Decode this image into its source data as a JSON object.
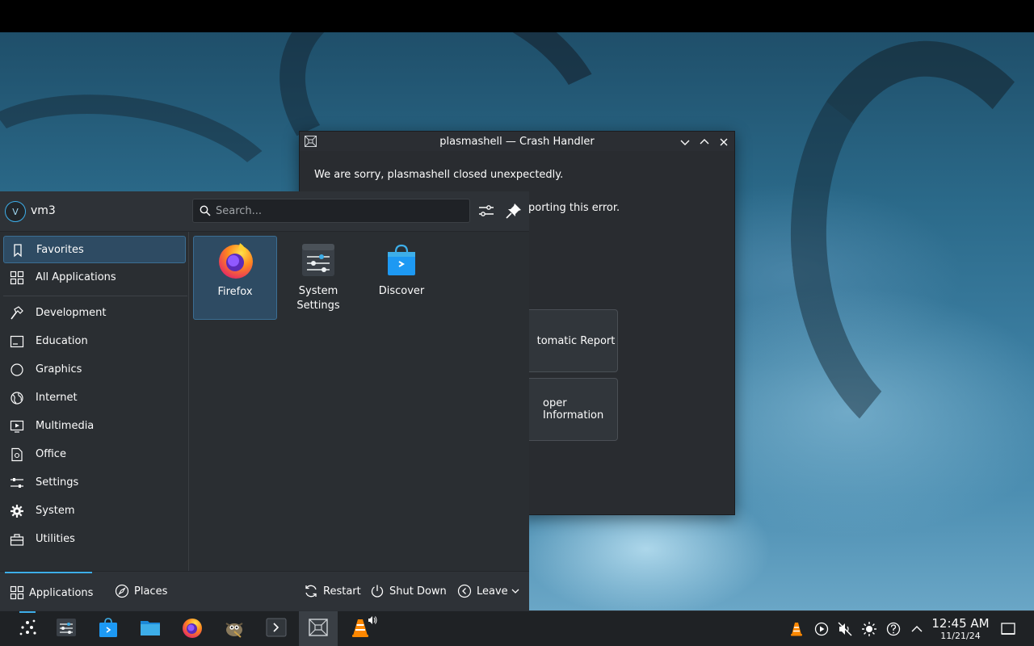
{
  "crash_dialog": {
    "title": "plasmashell — Crash Handler",
    "message": "We are sorry, plasmashell closed unexpectedly.",
    "message_partial": "porting this error.",
    "button_report": "tomatic Report",
    "button_developer": "oper Information",
    "icons": {
      "app": "crash-window-icon",
      "minimize": "chevron-down-icon",
      "maximize": "chevron-up-icon",
      "close": "close-icon"
    }
  },
  "launcher": {
    "user": {
      "avatar_letter": "V",
      "name": "vm3"
    },
    "search": {
      "placeholder": "Search..."
    },
    "header_icons": [
      "configure-icon",
      "pin-icon"
    ],
    "categories": [
      {
        "label": "Favorites",
        "icon": "bookmark-icon",
        "selected": true
      },
      {
        "label": "All Applications",
        "icon": "grid-icon"
      },
      {
        "label": "Development",
        "icon": "hammer-icon"
      },
      {
        "label": "Education",
        "icon": "education-icon"
      },
      {
        "label": "Graphics",
        "icon": "graphics-icon"
      },
      {
        "label": "Internet",
        "icon": "globe-icon"
      },
      {
        "label": "Multimedia",
        "icon": "multimedia-icon"
      },
      {
        "label": "Office",
        "icon": "office-icon"
      },
      {
        "label": "Settings",
        "icon": "sliders-icon"
      },
      {
        "label": "System",
        "icon": "cog-icon"
      },
      {
        "label": "Utilities",
        "icon": "toolbox-icon"
      }
    ],
    "favorites": [
      {
        "label": "Firefox",
        "icon": "firefox-icon",
        "selected": true
      },
      {
        "label": "System Settings",
        "icon": "system-settings-icon"
      },
      {
        "label": "Discover",
        "icon": "discover-icon"
      }
    ],
    "footer": {
      "tab_applications": "Applications",
      "tab_places": "Places",
      "restart": "Restart",
      "shutdown": "Shut Down",
      "leave": "Leave"
    }
  },
  "taskbar": {
    "items": [
      "application-launcher-icon",
      "system-settings-icon",
      "discover-icon",
      "file-manager-icon",
      "firefox-icon",
      "gimp-icon",
      "terminal-icon",
      "crash-handler-icon",
      "vlc-icon"
    ],
    "tray": [
      "vlc-tray-icon",
      "media-player-icon",
      "volume-muted-icon",
      "brightness-icon",
      "help-icon",
      "expand-tray-icon"
    ],
    "clock": {
      "time": "12:45 AM",
      "date": "11/21/24"
    },
    "show_desktop_icon": "show-desktop-icon"
  },
  "colors": {
    "accent": "#3daee9",
    "selection": "#2e4b63",
    "panel": "#2a2e32",
    "taskbar": "#1f2225"
  }
}
